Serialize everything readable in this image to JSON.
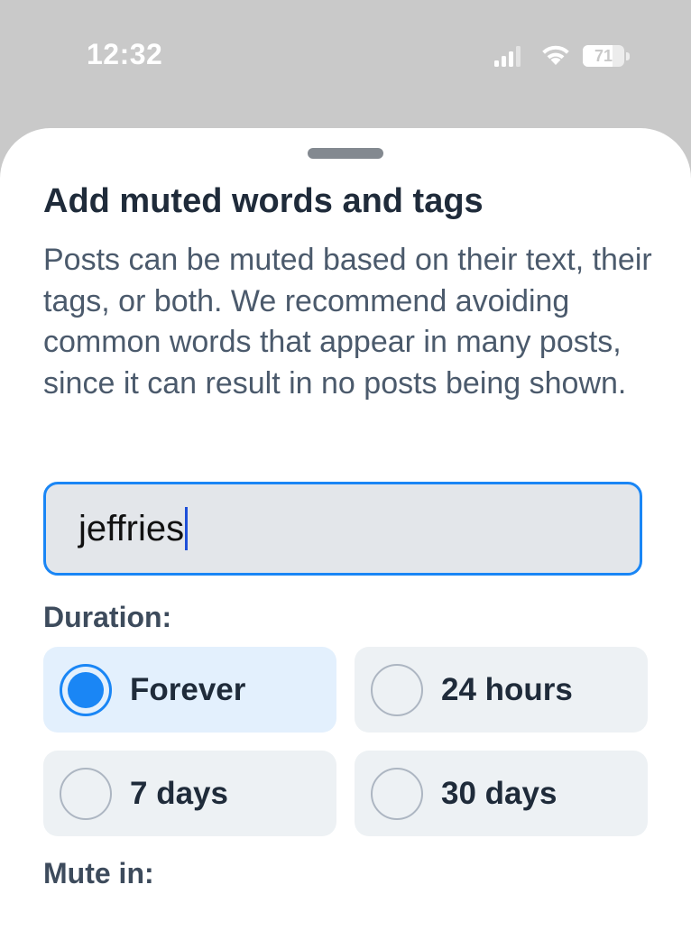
{
  "status_bar": {
    "time": "12:32",
    "battery": "71",
    "battery_level_percent": 71,
    "icons": [
      "cellular-signal-icon",
      "wifi-icon",
      "battery-icon"
    ]
  },
  "sheet": {
    "title": "Add muted words and tags",
    "description": "Posts can be muted based on their text, their tags, or both. We recommend avoiding common words that appear in many posts, since it can result in no posts being shown.",
    "input": {
      "value": "jeffries"
    },
    "duration": {
      "label": "Duration:",
      "options": [
        {
          "label": "Forever",
          "selected": true
        },
        {
          "label": "24 hours",
          "selected": false
        },
        {
          "label": "7 days",
          "selected": false
        },
        {
          "label": "30 days",
          "selected": false
        }
      ]
    },
    "mute_in": {
      "label": "Mute in:"
    }
  },
  "colors": {
    "accent": "#1a86f5",
    "title_text": "#1f2b3a",
    "body_text": "#4b5a6c",
    "backdrop": "#c9c9c9"
  }
}
